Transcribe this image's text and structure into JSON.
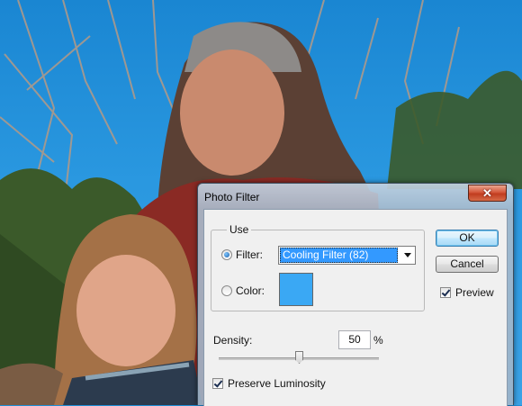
{
  "dialog": {
    "title": "Photo Filter",
    "close_label": "✕",
    "use_group": {
      "legend": "Use",
      "filter_label": "Filter:",
      "filter_selected": true,
      "filter_value": "Cooling Filter (82)",
      "color_label": "Color:",
      "color_selected": false,
      "swatch_color": "#3aa8f4"
    },
    "density": {
      "label": "Density:",
      "value": "50",
      "unit": "%",
      "slider_percent": 50
    },
    "preserve_luminosity": {
      "label": "Preserve Luminosity",
      "checked": true
    },
    "buttons": {
      "ok": "OK",
      "cancel": "Cancel"
    },
    "preview": {
      "label": "Preview",
      "checked": true
    }
  },
  "colors": {
    "sky": "#1f8fd8",
    "selection": "#3399ff",
    "close_button": "#c13c1f"
  }
}
